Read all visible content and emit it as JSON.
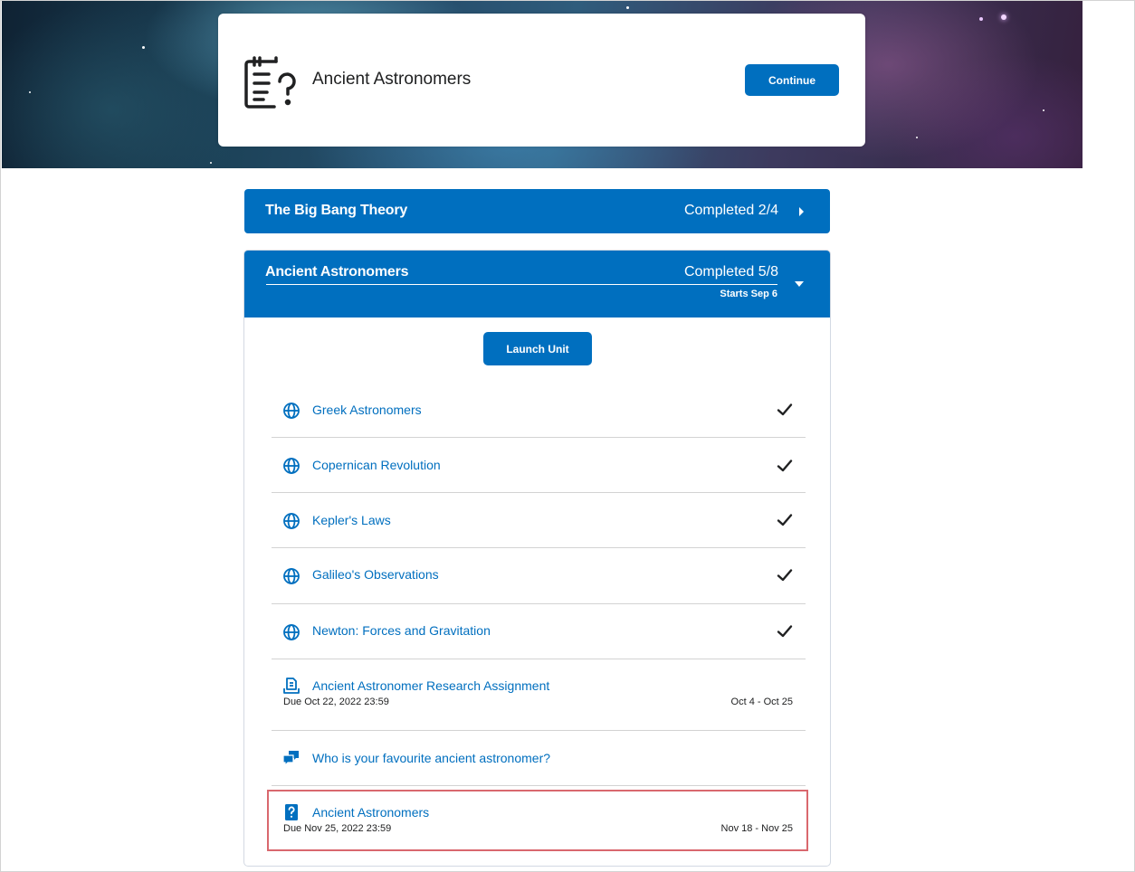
{
  "hero": {
    "icon": "quiz-document-icon",
    "title": "Ancient Astronomers",
    "continue_label": "Continue"
  },
  "units": [
    {
      "title": "The Big Bang Theory",
      "progress": "Completed 2/4",
      "state": "collapsed",
      "chevron": "chevron-right-icon"
    },
    {
      "title": "Ancient Astronomers",
      "progress": "Completed 5/8",
      "starts": "Starts Sep 6",
      "state": "expanded",
      "chevron": "chevron-down-icon",
      "launch_label": "Launch Unit",
      "items": [
        {
          "icon": "globe-icon",
          "title": "Greek Astronomers",
          "completed": true
        },
        {
          "icon": "globe-icon",
          "title": "Copernican Revolution",
          "completed": true
        },
        {
          "icon": "globe-icon",
          "title": "Kepler's Laws",
          "completed": true
        },
        {
          "icon": "globe-icon",
          "title": "Galileo's Observations",
          "completed": true
        },
        {
          "icon": "globe-icon",
          "title": "Newton: Forces and Gravitation",
          "completed": true
        },
        {
          "icon": "assignment-icon",
          "title": "Ancient Astronomer Research Assignment",
          "due": "Due Oct 22, 2022 23:59",
          "range": "Oct 4 - Oct 25"
        },
        {
          "icon": "discussion-icon",
          "title": "Who is your favourite ancient astronomer?"
        },
        {
          "icon": "quiz-icon",
          "title": "Ancient Astronomers",
          "due": "Due Nov 25, 2022 23:59",
          "range": "Nov 18 - Nov 25",
          "highlighted": true
        }
      ]
    }
  ],
  "colors": {
    "primary": "#006fbf",
    "text": "#202122",
    "divider": "#d3d3d3",
    "highlight_border": "#d9686e"
  }
}
